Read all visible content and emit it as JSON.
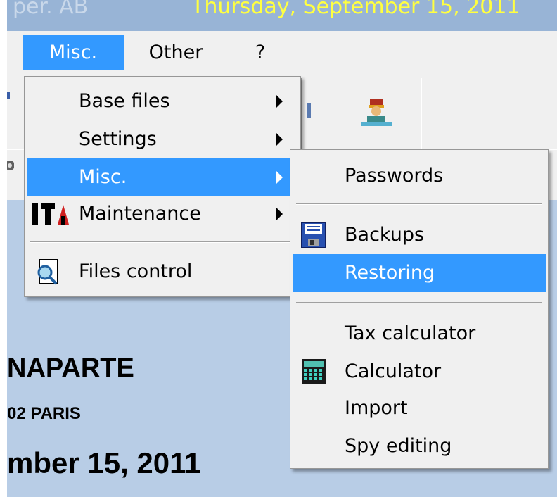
{
  "titlebar": {
    "app_name": "per. AB",
    "date": "Thursday, September 15, 2011"
  },
  "menubar": {
    "items": [
      {
        "label": "Misc.",
        "active": true
      },
      {
        "label": "Other",
        "active": false
      },
      {
        "label": "?",
        "active": false
      }
    ]
  },
  "misc_menu": {
    "items": [
      {
        "label": "Base files",
        "submenu": true
      },
      {
        "label": "Settings",
        "submenu": true
      },
      {
        "label": "Misc.",
        "submenu": true,
        "highlighted": true
      },
      {
        "label": "Maintenance",
        "submenu": true,
        "icon": "maintenance-tools-icon"
      },
      {
        "label": "Files control",
        "icon": "magnifier-document-icon"
      }
    ]
  },
  "misc_submenu": {
    "items": [
      {
        "label": "Passwords"
      },
      {
        "label": "Backups",
        "icon": "floppy-disk-icon"
      },
      {
        "label": "Restoring",
        "highlighted": true
      },
      {
        "label": "Tax calculator"
      },
      {
        "label": "Calculator",
        "icon": "calculator-icon"
      },
      {
        "label": "Import"
      },
      {
        "label": "Spy editing"
      }
    ]
  },
  "main": {
    "company_name": "NAPARTE",
    "city": "02 PARIS",
    "date": "mber 15, 2011"
  },
  "colors": {
    "highlight": "#3399ff",
    "titlebar": "#98b4d6",
    "main_background": "#b8cde6",
    "date_text": "#ffff40"
  }
}
